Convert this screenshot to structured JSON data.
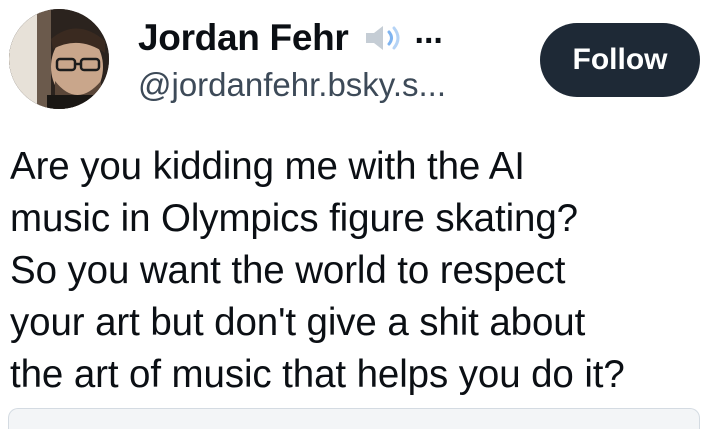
{
  "author": {
    "display_name": "Jordan Fehr",
    "handle": "@jordanfehr.bsky.s...",
    "badge_icon": "speaker-icon",
    "ellipsis": "..."
  },
  "follow_button": {
    "label": "Follow"
  },
  "post": {
    "text": "Are you kidding me with the AI\nmusic in Olympics figure skating?\nSo you want the world to respect\nyour art but don't give a shit about\nthe art of music that helps you do it?"
  },
  "colors": {
    "text": "#0b0f14",
    "handle": "#3d4a58",
    "follow_bg": "#1e2936",
    "follow_text": "#ffffff"
  }
}
